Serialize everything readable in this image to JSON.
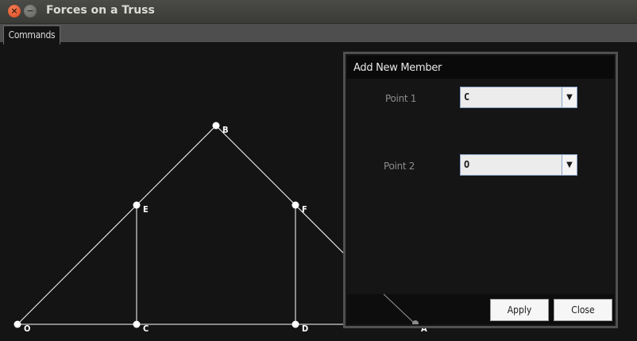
{
  "window": {
    "title": "Forces on a Truss",
    "close_symbol": "×",
    "minimize_symbol": "−"
  },
  "tabs": [
    {
      "label": "Commands"
    }
  ],
  "truss": {
    "nodes": [
      {
        "id": "O",
        "label": "O"
      },
      {
        "id": "C",
        "label": "C"
      },
      {
        "id": "D",
        "label": "D"
      },
      {
        "id": "A",
        "label": "A"
      },
      {
        "id": "E",
        "label": "E"
      },
      {
        "id": "F",
        "label": "F"
      },
      {
        "id": "B",
        "label": "B"
      }
    ],
    "members": [
      [
        "O",
        "C"
      ],
      [
        "C",
        "D"
      ],
      [
        "D",
        "A"
      ],
      [
        "O",
        "E"
      ],
      [
        "E",
        "B"
      ],
      [
        "B",
        "F"
      ],
      [
        "F",
        "A"
      ],
      [
        "E",
        "C"
      ],
      [
        "F",
        "D"
      ]
    ],
    "line_color": "#ffffff",
    "node_color": "#ffffff"
  },
  "dialog": {
    "title": "Add New Member",
    "point1": {
      "label": "Point 1",
      "value": "C",
      "arrow": "▼"
    },
    "point2": {
      "label": "Point 2",
      "value": "O",
      "arrow": "▼"
    },
    "apply_label": "Apply",
    "close_label": "Close"
  }
}
